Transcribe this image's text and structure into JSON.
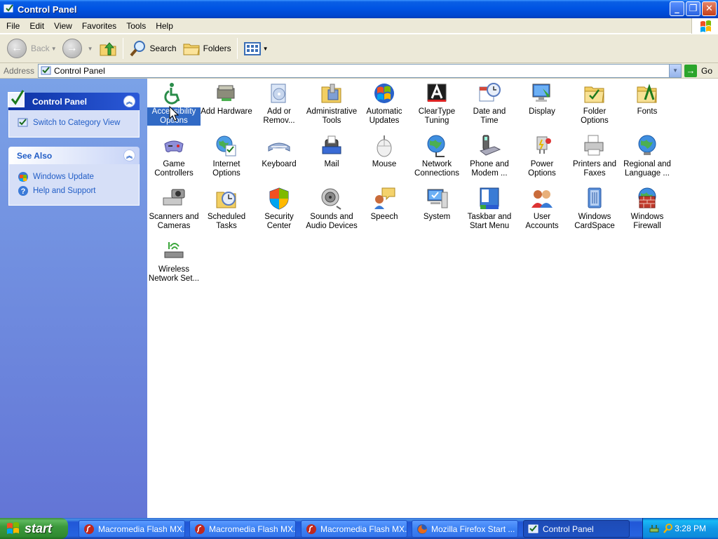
{
  "window": {
    "title": "Control Panel"
  },
  "menubar": {
    "items": [
      "File",
      "Edit",
      "View",
      "Favorites",
      "Tools",
      "Help"
    ]
  },
  "toolbar": {
    "back": "Back",
    "search": "Search",
    "folders": "Folders"
  },
  "address": {
    "label": "Address",
    "value": "Control Panel",
    "go": "Go"
  },
  "leftpane": {
    "panel_title": "Control Panel",
    "switch_link": "Switch to Category View",
    "see_also_title": "See Also",
    "see_also": [
      "Windows Update",
      "Help and Support"
    ]
  },
  "icons": [
    {
      "label": "Accessibility Options",
      "icon": "accessibility-icon",
      "selected": true
    },
    {
      "label": "Add Hardware",
      "icon": "add-hardware-icon"
    },
    {
      "label": "Add or Remov...",
      "icon": "add-remove-programs-icon"
    },
    {
      "label": "Administrative Tools",
      "icon": "administrative-tools-icon"
    },
    {
      "label": "Automatic Updates",
      "icon": "automatic-updates-icon"
    },
    {
      "label": "ClearType Tuning",
      "icon": "cleartype-icon"
    },
    {
      "label": "Date and Time",
      "icon": "date-time-icon"
    },
    {
      "label": "Display",
      "icon": "display-icon"
    },
    {
      "label": "Folder Options",
      "icon": "folder-options-icon"
    },
    {
      "label": "Fonts",
      "icon": "fonts-icon"
    },
    {
      "label": "Game Controllers",
      "icon": "game-controllers-icon"
    },
    {
      "label": "Internet Options",
      "icon": "internet-options-icon"
    },
    {
      "label": "Keyboard",
      "icon": "keyboard-icon"
    },
    {
      "label": "Mail",
      "icon": "mail-icon"
    },
    {
      "label": "Mouse",
      "icon": "mouse-icon"
    },
    {
      "label": "Network Connections",
      "icon": "network-connections-icon"
    },
    {
      "label": "Phone and Modem ...",
      "icon": "phone-modem-icon"
    },
    {
      "label": "Power Options",
      "icon": "power-options-icon"
    },
    {
      "label": "Printers and Faxes",
      "icon": "printers-faxes-icon"
    },
    {
      "label": "Regional and Language ...",
      "icon": "regional-language-icon"
    },
    {
      "label": "Scanners and Cameras",
      "icon": "scanners-cameras-icon"
    },
    {
      "label": "Scheduled Tasks",
      "icon": "scheduled-tasks-icon"
    },
    {
      "label": "Security Center",
      "icon": "security-center-icon"
    },
    {
      "label": "Sounds and Audio Devices",
      "icon": "sounds-audio-icon"
    },
    {
      "label": "Speech",
      "icon": "speech-icon"
    },
    {
      "label": "System",
      "icon": "system-icon"
    },
    {
      "label": "Taskbar and Start Menu",
      "icon": "taskbar-start-menu-icon"
    },
    {
      "label": "User Accounts",
      "icon": "user-accounts-icon"
    },
    {
      "label": "Windows CardSpace",
      "icon": "cardspace-icon"
    },
    {
      "label": "Windows Firewall",
      "icon": "firewall-icon"
    },
    {
      "label": "Wireless Network Set...",
      "icon": "wireless-network-icon"
    }
  ],
  "taskbar": {
    "start": "start",
    "buttons": [
      {
        "label": "Macromedia Flash MX...",
        "icon": "flash-icon"
      },
      {
        "label": "Macromedia Flash MX...",
        "icon": "flash-icon"
      },
      {
        "label": "Macromedia Flash MX...",
        "icon": "flash-icon"
      },
      {
        "label": "Mozilla Firefox Start ...",
        "icon": "firefox-icon"
      },
      {
        "label": "Control Panel",
        "icon": "control-panel-icon",
        "active": true
      }
    ],
    "clock": "3:28 PM"
  }
}
